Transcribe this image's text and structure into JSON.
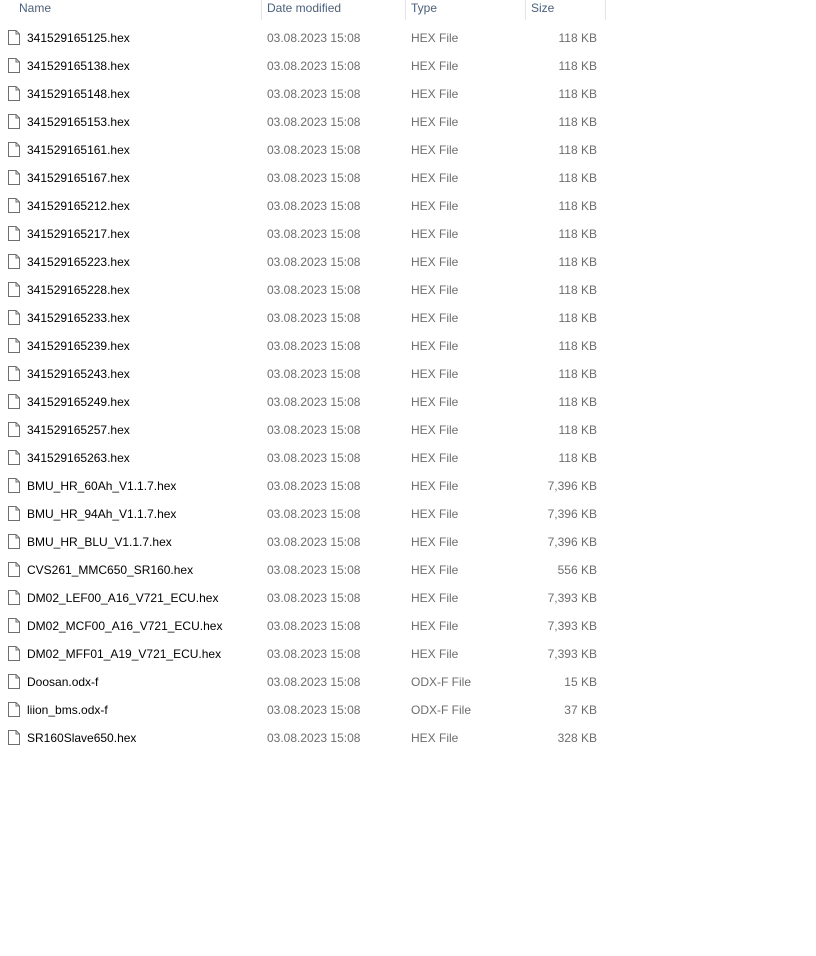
{
  "columns": {
    "name": "Name",
    "date": "Date modified",
    "type": "Type",
    "size": "Size"
  },
  "files": [
    {
      "name": "341529165125.hex",
      "date": "03.08.2023 15:08",
      "type": "HEX File",
      "size": "118 KB",
      "icon": "file-icon"
    },
    {
      "name": "341529165138.hex",
      "date": "03.08.2023 15:08",
      "type": "HEX File",
      "size": "118 KB",
      "icon": "file-icon"
    },
    {
      "name": "341529165148.hex",
      "date": "03.08.2023 15:08",
      "type": "HEX File",
      "size": "118 KB",
      "icon": "file-icon"
    },
    {
      "name": "341529165153.hex",
      "date": "03.08.2023 15:08",
      "type": "HEX File",
      "size": "118 KB",
      "icon": "file-icon"
    },
    {
      "name": "341529165161.hex",
      "date": "03.08.2023 15:08",
      "type": "HEX File",
      "size": "118 KB",
      "icon": "file-icon"
    },
    {
      "name": "341529165167.hex",
      "date": "03.08.2023 15:08",
      "type": "HEX File",
      "size": "118 KB",
      "icon": "file-icon"
    },
    {
      "name": "341529165212.hex",
      "date": "03.08.2023 15:08",
      "type": "HEX File",
      "size": "118 KB",
      "icon": "file-icon"
    },
    {
      "name": "341529165217.hex",
      "date": "03.08.2023 15:08",
      "type": "HEX File",
      "size": "118 KB",
      "icon": "file-icon"
    },
    {
      "name": "341529165223.hex",
      "date": "03.08.2023 15:08",
      "type": "HEX File",
      "size": "118 KB",
      "icon": "file-icon"
    },
    {
      "name": "341529165228.hex",
      "date": "03.08.2023 15:08",
      "type": "HEX File",
      "size": "118 KB",
      "icon": "file-icon"
    },
    {
      "name": "341529165233.hex",
      "date": "03.08.2023 15:08",
      "type": "HEX File",
      "size": "118 KB",
      "icon": "file-icon"
    },
    {
      "name": "341529165239.hex",
      "date": "03.08.2023 15:08",
      "type": "HEX File",
      "size": "118 KB",
      "icon": "file-icon"
    },
    {
      "name": "341529165243.hex",
      "date": "03.08.2023 15:08",
      "type": "HEX File",
      "size": "118 KB",
      "icon": "file-icon"
    },
    {
      "name": "341529165249.hex",
      "date": "03.08.2023 15:08",
      "type": "HEX File",
      "size": "118 KB",
      "icon": "file-icon"
    },
    {
      "name": "341529165257.hex",
      "date": "03.08.2023 15:08",
      "type": "HEX File",
      "size": "118 KB",
      "icon": "file-icon"
    },
    {
      "name": "341529165263.hex",
      "date": "03.08.2023 15:08",
      "type": "HEX File",
      "size": "118 KB",
      "icon": "file-icon"
    },
    {
      "name": "BMU_HR_60Ah_V1.1.7.hex",
      "date": "03.08.2023 15:08",
      "type": "HEX File",
      "size": "7,396 KB",
      "icon": "file-icon"
    },
    {
      "name": "BMU_HR_94Ah_V1.1.7.hex",
      "date": "03.08.2023 15:08",
      "type": "HEX File",
      "size": "7,396 KB",
      "icon": "file-icon"
    },
    {
      "name": "BMU_HR_BLU_V1.1.7.hex",
      "date": "03.08.2023 15:08",
      "type": "HEX File",
      "size": "7,396 KB",
      "icon": "file-icon"
    },
    {
      "name": "CVS261_MMC650_SR160.hex",
      "date": "03.08.2023 15:08",
      "type": "HEX File",
      "size": "556 KB",
      "icon": "file-icon"
    },
    {
      "name": "DM02_LEF00_A16_V721_ECU.hex",
      "date": "03.08.2023 15:08",
      "type": "HEX File",
      "size": "7,393 KB",
      "icon": "file-icon"
    },
    {
      "name": "DM02_MCF00_A16_V721_ECU.hex",
      "date": "03.08.2023 15:08",
      "type": "HEX File",
      "size": "7,393 KB",
      "icon": "file-icon"
    },
    {
      "name": "DM02_MFF01_A19_V721_ECU.hex",
      "date": "03.08.2023 15:08",
      "type": "HEX File",
      "size": "7,393 KB",
      "icon": "file-icon"
    },
    {
      "name": "Doosan.odx-f",
      "date": "03.08.2023 15:08",
      "type": "ODX-F File",
      "size": "15 KB",
      "icon": "file-icon"
    },
    {
      "name": "liion_bms.odx-f",
      "date": "03.08.2023 15:08",
      "type": "ODX-F File",
      "size": "37 KB",
      "icon": "file-icon"
    },
    {
      "name": "SR160Slave650.hex",
      "date": "03.08.2023 15:08",
      "type": "HEX File",
      "size": "328 KB",
      "icon": "file-icon"
    }
  ],
  "colors": {
    "header_text": "#4c607a",
    "secondary_text": "#6d6d6d",
    "primary_text": "#000000",
    "column_separator": "#e5e5e5",
    "row_hover": "#e5f3ff"
  }
}
